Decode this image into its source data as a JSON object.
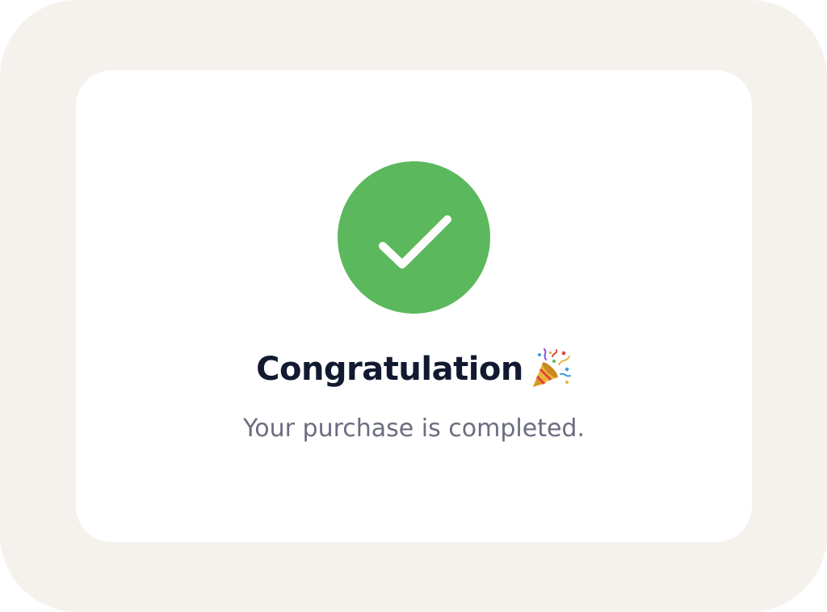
{
  "dialog": {
    "status_icon": "check-circle-icon",
    "decor_icon": "party-popper-icon",
    "title": "Congratulation",
    "message": "Your purchase is completed."
  },
  "colors": {
    "outer_background": "#f5f1ed",
    "card_background": "#ffffff",
    "success_green": "#5cb85c",
    "title_text": "#111a30",
    "message_text": "#6b6d80"
  }
}
